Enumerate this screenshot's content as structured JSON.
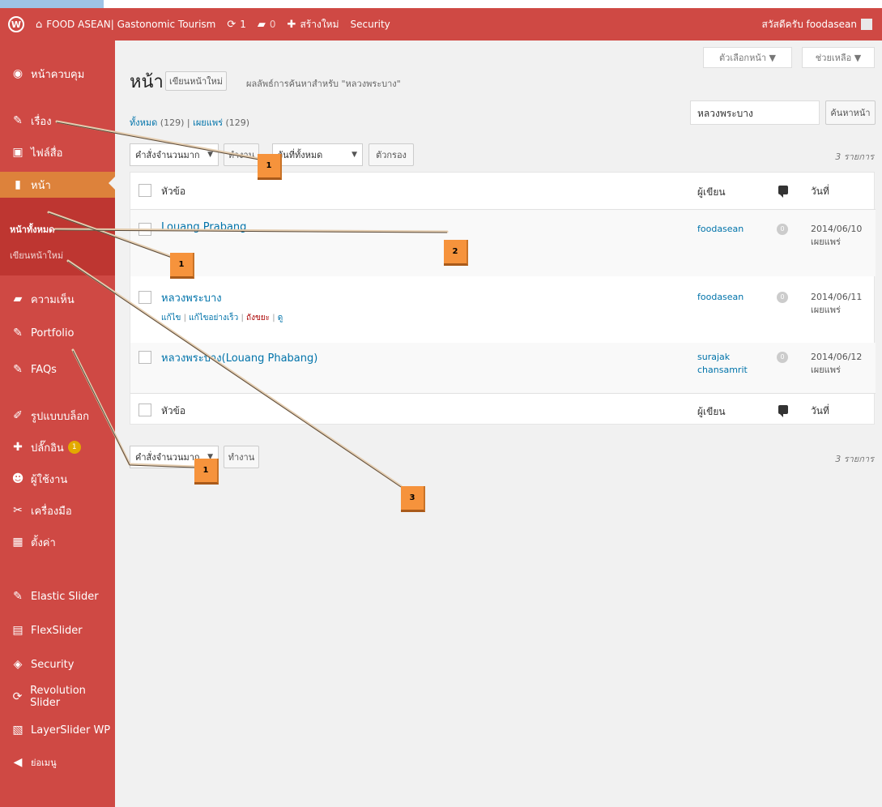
{
  "adminbar": {
    "site_title": "FOOD ASEAN| Gastonomic Tourism",
    "updates_count": "1",
    "comments_count": "0",
    "new_label": "สร้างใหม่",
    "security_label": "Security",
    "greeting": "สวัสดีครับ foodasean"
  },
  "sidebar": {
    "items": [
      {
        "label": "หน้าควบคุม",
        "icon": "dashboard-icon",
        "glyph": "◉"
      },
      {
        "label": "เรื่อง",
        "icon": "pin-icon",
        "glyph": "✎"
      },
      {
        "label": "ไฟล์สื่อ",
        "icon": "media-icon",
        "glyph": "▣"
      },
      {
        "label": "หน้า",
        "icon": "page-icon",
        "glyph": "▮"
      },
      {
        "label": "ความเห็น",
        "icon": "comment-icon",
        "glyph": "▰"
      },
      {
        "label": "Portfolio",
        "icon": "pin-icon",
        "glyph": "✎"
      },
      {
        "label": "FAQs",
        "icon": "pin-icon",
        "glyph": "✎"
      },
      {
        "label": "รูปแบบบล็อก",
        "icon": "appearance-icon",
        "glyph": "✐"
      },
      {
        "label": "ปลั๊กอิน",
        "icon": "plugin-icon",
        "glyph": "✚",
        "badge": "1"
      },
      {
        "label": "ผู้ใช้งาน",
        "icon": "user-icon",
        "glyph": "☻"
      },
      {
        "label": "เครื่องมือ",
        "icon": "tools-icon",
        "glyph": "✂"
      },
      {
        "label": "ตั้งค่า",
        "icon": "settings-icon",
        "glyph": "▦"
      },
      {
        "label": "Elastic Slider",
        "icon": "pin-icon",
        "glyph": "✎"
      },
      {
        "label": "FlexSlider",
        "icon": "image-icon",
        "glyph": "▤"
      },
      {
        "label": "Security",
        "icon": "shield-icon",
        "glyph": "◈"
      },
      {
        "label": "Revolution Slider",
        "icon": "refresh-icon",
        "glyph": "⟳"
      },
      {
        "label": "LayerSlider WP",
        "icon": "layers-icon",
        "glyph": "▧"
      },
      {
        "label": "ย่อเมนู",
        "icon": "collapse-icon",
        "glyph": "◀"
      }
    ],
    "submenu": {
      "all_pages": "หน้าทั้งหมด",
      "add_new": "เขียนหน้าใหม่"
    }
  },
  "main": {
    "screen_options": "ตัวเลือกหน้า ▼",
    "help": "ช่วยเหลือ ▼",
    "title": "หน้า",
    "add_new_button": "เขียนหน้าใหม่",
    "search_result": "ผลลัพธ์การค้นหาสำหรับ \"หลวงพระบาง\"",
    "filters": {
      "all_label": "ทั้งหมด",
      "all_count": "(129)",
      "separator": "|",
      "published_label": "เผยแพร่",
      "published_count": "(129)"
    },
    "search": {
      "value": "หลวงพระบาง",
      "button": "ค้นหาหน้า"
    },
    "bulk_actions_top": "คำสั่งจำนวนมาก",
    "apply_button": "ทำงาน",
    "dates_filter": "วันที่ทั้งหมด",
    "filter_button": "ตัวกรอง",
    "items_count": "3 รายการ",
    "bulk_actions_bottom": "คำสั่งจำนวนมาก",
    "columns": {
      "title": "หัวข้อ",
      "author": "ผู้เขียน",
      "date": "วันที่"
    },
    "rows": [
      {
        "title": "Louang Prabang",
        "author": "foodasean",
        "comments": "0",
        "date": "2014/06/10",
        "status": "เผยแพร่"
      },
      {
        "title": "หลวงพระบาง",
        "author": "foodasean",
        "comments": "0",
        "date": "2014/06/11",
        "status": "เผยแพร่"
      },
      {
        "title": "หลวงพระบาง(Louang Phabang)",
        "author": "surajak chansamrit",
        "comments": "0",
        "date": "2014/06/12",
        "status": "เผยแพร่"
      }
    ],
    "row_actions": {
      "edit": "แก้ไข",
      "quick_edit": "แก้ไขอย่างเร็ว",
      "trash": "ถังขยะ",
      "view": "ดู",
      "sep": "|"
    }
  },
  "annotations": {
    "markers": [
      "1",
      "2",
      "1",
      "1",
      "3"
    ]
  },
  "colors": {
    "admin_red": "#cf4944",
    "menu_current": "#dd823b",
    "submenu_bg": "#be3631",
    "marker_orange": "#f6933c",
    "link_blue": "#0073aa"
  }
}
